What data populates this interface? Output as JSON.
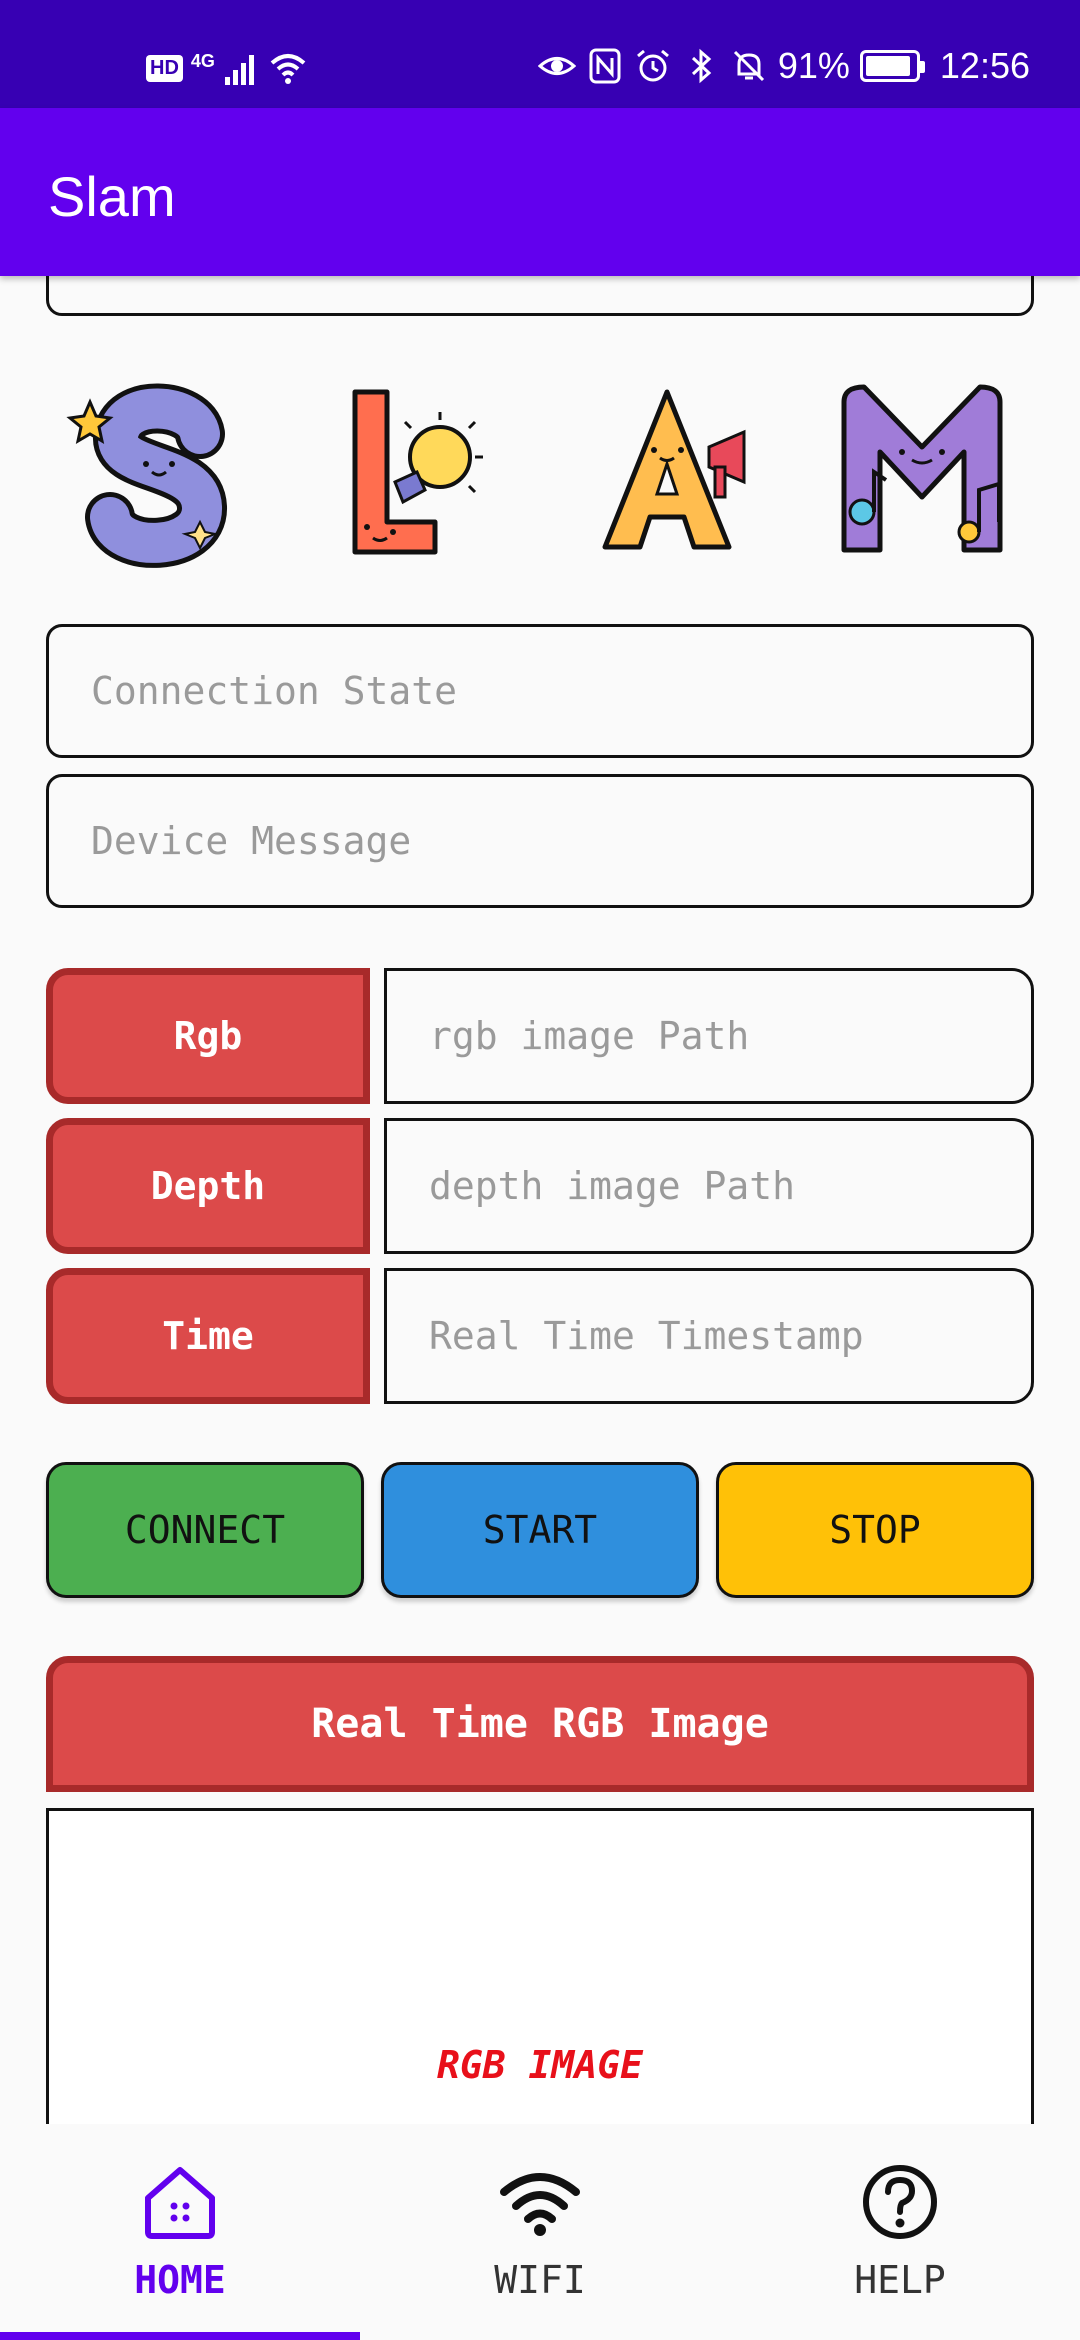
{
  "status_bar": {
    "network_badge": "HD",
    "network_type": "4G",
    "battery_text": "91%",
    "battery_level": 0.91,
    "time": "12:56"
  },
  "app_bar": {
    "title": "Slam"
  },
  "fields": {
    "connection_state_placeholder": "Connection State",
    "device_message_placeholder": "Device Message"
  },
  "image_rows": [
    {
      "button_label": "Rgb",
      "field_placeholder": "rgb image Path"
    },
    {
      "button_label": "Depth",
      "field_placeholder": "depth image Path"
    },
    {
      "button_label": "Time",
      "field_placeholder": "Real Time Timestamp"
    }
  ],
  "actions": {
    "connect_label": "CONNECT",
    "start_label": "START",
    "stop_label": "STOP",
    "connect_color": "#4caf50",
    "start_color": "#2f8fdd",
    "stop_color": "#ffc107"
  },
  "realtime": {
    "header_label": "Real Time RGB Image",
    "image_placeholder": "RGB IMAGE"
  },
  "bottom_nav": {
    "items": [
      {
        "label": "HOME",
        "icon": "home-icon",
        "active": true
      },
      {
        "label": "WIFI",
        "icon": "wifi-icon",
        "active": false
      },
      {
        "label": "HELP",
        "icon": "help-icon",
        "active": false
      }
    ]
  },
  "colors": {
    "status_bar": "#3700b3",
    "app_bar": "#6200ee",
    "red_button": "#dc4a4a",
    "red_border": "#a82a2a",
    "rgb_image_text": "#e8101a"
  }
}
